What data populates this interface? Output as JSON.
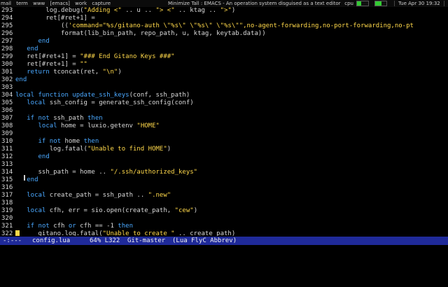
{
  "topbar": {
    "tabs": [
      "mail",
      "term",
      "www",
      "[emacs]",
      "work",
      "capture"
    ],
    "title": "Minimize Tall : EMACS - An operation system disguised as a text editor",
    "cpu_label": "cpu",
    "cpu_level": 0.35,
    "mem_level": 0.55,
    "datetime": "Tue Apr 30 19:32"
  },
  "lines": [
    {
      "n": "293",
      "code": [
        {
          "t": "        log.debug(",
          "c": ""
        },
        {
          "t": "\"Adding <\"",
          "c": "str"
        },
        {
          "t": " .. u .. ",
          "c": ""
        },
        {
          "t": "\"> <\"",
          "c": "str"
        },
        {
          "t": " .. ktag .. ",
          "c": ""
        },
        {
          "t": "\">\"",
          "c": "str"
        },
        {
          "t": ")",
          "c": ""
        }
      ]
    },
    {
      "n": "294",
      "code": [
        {
          "t": "        ret[#ret+1] =",
          "c": ""
        }
      ]
    },
    {
      "n": "295",
      "code": [
        {
          "t": "            ((",
          "c": ""
        },
        {
          "t": "'command=\"%s/gitano-auth \\\"%s\\\" \\\"%s\\\" \\\"%s\\\"\",no-agent-forwarding,no-port-forwarding,no-pt",
          "c": "str"
        }
      ]
    },
    {
      "n": "296",
      "code": [
        {
          "t": "            format(lib_bin_path, repo_path, u, ktag, keytab.data))",
          "c": ""
        }
      ]
    },
    {
      "n": "297",
      "code": [
        {
          "t": "      ",
          "c": ""
        },
        {
          "t": "end",
          "c": "kw"
        }
      ]
    },
    {
      "n": "298",
      "code": [
        {
          "t": "   ",
          "c": ""
        },
        {
          "t": "end",
          "c": "kw"
        }
      ]
    },
    {
      "n": "299",
      "code": [
        {
          "t": "   ret[#ret+1] = ",
          "c": ""
        },
        {
          "t": "\"### End Gitano Keys ###\"",
          "c": "str"
        }
      ]
    },
    {
      "n": "300",
      "code": [
        {
          "t": "   ret[#ret+1] = ",
          "c": ""
        },
        {
          "t": "\"\"",
          "c": "str"
        }
      ]
    },
    {
      "n": "301",
      "code": [
        {
          "t": "   ",
          "c": ""
        },
        {
          "t": "return",
          "c": "kw"
        },
        {
          "t": " tconcat(ret, ",
          "c": ""
        },
        {
          "t": "\"\\n\"",
          "c": "str"
        },
        {
          "t": ")",
          "c": ""
        }
      ]
    },
    {
      "n": "302",
      "code": [
        {
          "t": "end",
          "c": "kw"
        }
      ]
    },
    {
      "n": "303",
      "code": []
    },
    {
      "n": "304",
      "code": [
        {
          "t": "local",
          "c": "kw"
        },
        {
          "t": " ",
          "c": ""
        },
        {
          "t": "function",
          "c": "kw"
        },
        {
          "t": " ",
          "c": ""
        },
        {
          "t": "update_ssh_keys",
          "c": "fn"
        },
        {
          "t": "(conf, ssh_path)",
          "c": ""
        }
      ]
    },
    {
      "n": "305",
      "code": [
        {
          "t": "   ",
          "c": ""
        },
        {
          "t": "local",
          "c": "kw"
        },
        {
          "t": " ssh_config = generate_ssh_config(conf)",
          "c": ""
        }
      ]
    },
    {
      "n": "306",
      "code": []
    },
    {
      "n": "307",
      "code": [
        {
          "t": "   ",
          "c": ""
        },
        {
          "t": "if",
          "c": "kw"
        },
        {
          "t": " ",
          "c": ""
        },
        {
          "t": "not",
          "c": "kw"
        },
        {
          "t": " ssh_path ",
          "c": ""
        },
        {
          "t": "then",
          "c": "kw"
        }
      ]
    },
    {
      "n": "308",
      "code": [
        {
          "t": "      ",
          "c": ""
        },
        {
          "t": "local",
          "c": "kw"
        },
        {
          "t": " home = luxio.getenv ",
          "c": ""
        },
        {
          "t": "\"HOME\"",
          "c": "str"
        }
      ]
    },
    {
      "n": "309",
      "code": []
    },
    {
      "n": "310",
      "code": [
        {
          "t": "      ",
          "c": ""
        },
        {
          "t": "if",
          "c": "kw"
        },
        {
          "t": " ",
          "c": ""
        },
        {
          "t": "not",
          "c": "kw"
        },
        {
          "t": " home ",
          "c": ""
        },
        {
          "t": "then",
          "c": "kw"
        }
      ]
    },
    {
      "n": "311",
      "code": [
        {
          "t": "         log.fatal(",
          "c": ""
        },
        {
          "t": "\"Unable to find HOME\"",
          "c": "str"
        },
        {
          "t": ")",
          "c": ""
        }
      ]
    },
    {
      "n": "312",
      "code": [
        {
          "t": "      ",
          "c": ""
        },
        {
          "t": "end",
          "c": "kw"
        }
      ]
    },
    {
      "n": "313",
      "code": []
    },
    {
      "n": "314",
      "code": [
        {
          "t": "      ssh_path = home .. ",
          "c": ""
        },
        {
          "t": "\"/.ssh/authorized_keys\"",
          "c": "str"
        }
      ]
    },
    {
      "n": "315",
      "code": [
        {
          "t": "   ",
          "c": ""
        },
        {
          "t": "end",
          "c": "kw"
        }
      ]
    },
    {
      "n": "316",
      "code": []
    },
    {
      "n": "317",
      "code": [
        {
          "t": "   ",
          "c": ""
        },
        {
          "t": "local",
          "c": "kw"
        },
        {
          "t": " create_path = ssh_path .. ",
          "c": ""
        },
        {
          "t": "\".new\"",
          "c": "str"
        }
      ]
    },
    {
      "n": "318",
      "code": []
    },
    {
      "n": "319",
      "code": [
        {
          "t": "   ",
          "c": ""
        },
        {
          "t": "local",
          "c": "kw"
        },
        {
          "t": " cfh, err = sio.open(create_path, ",
          "c": ""
        },
        {
          "t": "\"cew\"",
          "c": "str"
        },
        {
          "t": ")",
          "c": ""
        }
      ]
    },
    {
      "n": "320",
      "code": []
    },
    {
      "n": "321",
      "code": [
        {
          "t": "   ",
          "c": ""
        },
        {
          "t": "if",
          "c": "kw"
        },
        {
          "t": " ",
          "c": ""
        },
        {
          "t": "not",
          "c": "kw"
        },
        {
          "t": " cfh ",
          "c": ""
        },
        {
          "t": "or",
          "c": "kw"
        },
        {
          "t": " cfh == -1 ",
          "c": ""
        },
        {
          "t": "then",
          "c": "kw"
        }
      ]
    },
    {
      "n": "322",
      "code": [
        {
          "t": "      gitano.log.fatal(",
          "c": ""
        },
        {
          "t": "\"Unable to create \"",
          "c": "str"
        },
        {
          "t": " .. create_path)",
          "c": ""
        }
      ]
    }
  ],
  "colors": {
    "keyword": "#4aa8ff",
    "string": "#ffd84a",
    "modeline_bg": "#1f2a99"
  },
  "modeline": {
    "status": "-:---",
    "buffer": "config.lua",
    "position": "64% L322",
    "vc": "Git-master",
    "modes": "(Lua FlyC Abbrev)"
  }
}
